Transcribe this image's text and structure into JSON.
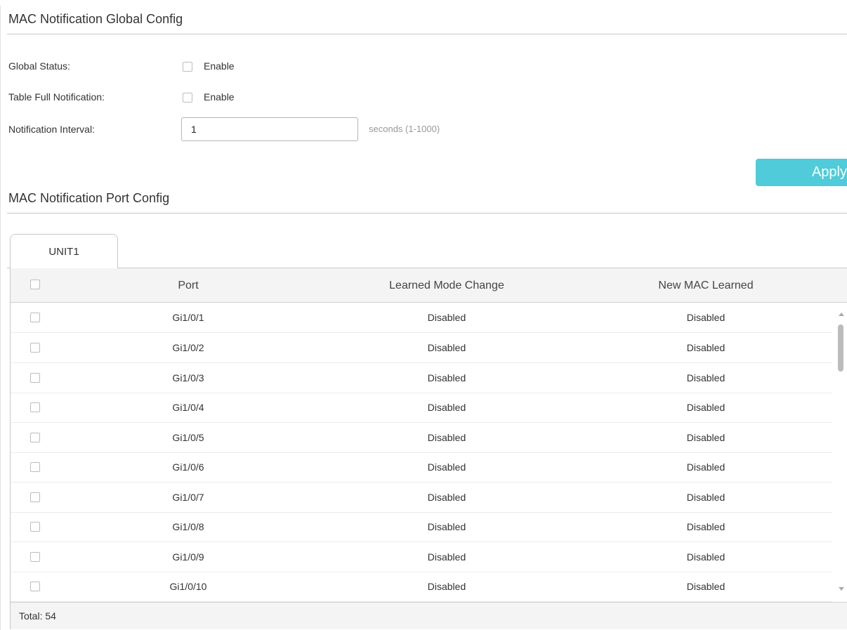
{
  "global_config": {
    "title": "MAC Notification Global Config",
    "global_status": {
      "label": "Global Status:",
      "option": "Enable",
      "checked": false
    },
    "table_full": {
      "label": "Table Full Notification:",
      "option": "Enable",
      "checked": false
    },
    "interval": {
      "label": "Notification Interval:",
      "value": "1",
      "hint": "seconds (1-1000)"
    },
    "apply_label": "Apply"
  },
  "port_config": {
    "title": "MAC Notification Port Config",
    "tabs": [
      {
        "label": "UNIT1",
        "active": true
      }
    ],
    "columns": [
      "Port",
      "Learned Mode Change",
      "New MAC Learned"
    ],
    "rows": [
      {
        "port": "Gi1/0/1",
        "learned_mode_change": "Disabled",
        "new_mac_learned": "Disabled"
      },
      {
        "port": "Gi1/0/2",
        "learned_mode_change": "Disabled",
        "new_mac_learned": "Disabled"
      },
      {
        "port": "Gi1/0/3",
        "learned_mode_change": "Disabled",
        "new_mac_learned": "Disabled"
      },
      {
        "port": "Gi1/0/4",
        "learned_mode_change": "Disabled",
        "new_mac_learned": "Disabled"
      },
      {
        "port": "Gi1/0/5",
        "learned_mode_change": "Disabled",
        "new_mac_learned": "Disabled"
      },
      {
        "port": "Gi1/0/6",
        "learned_mode_change": "Disabled",
        "new_mac_learned": "Disabled"
      },
      {
        "port": "Gi1/0/7",
        "learned_mode_change": "Disabled",
        "new_mac_learned": "Disabled"
      },
      {
        "port": "Gi1/0/8",
        "learned_mode_change": "Disabled",
        "new_mac_learned": "Disabled"
      },
      {
        "port": "Gi1/0/9",
        "learned_mode_change": "Disabled",
        "new_mac_learned": "Disabled"
      },
      {
        "port": "Gi1/0/10",
        "learned_mode_change": "Disabled",
        "new_mac_learned": "Disabled"
      }
    ],
    "footer": "Total: 54"
  },
  "colors": {
    "accent": "#4fcbd9",
    "border": "#c8c8c8",
    "header_bg": "#f4f4f4"
  }
}
